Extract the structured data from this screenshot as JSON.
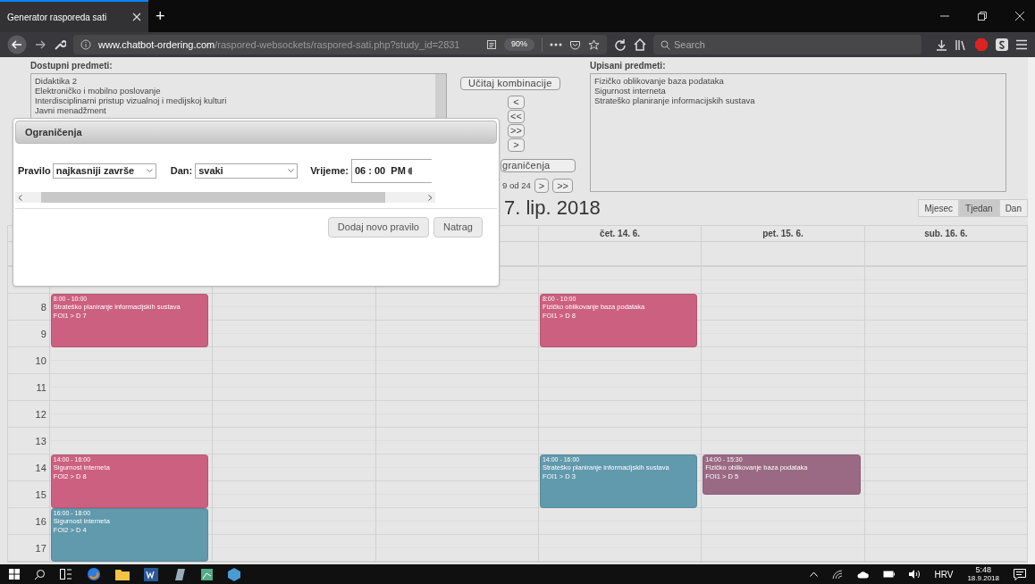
{
  "browser": {
    "tab_title": "Generator rasporeda sati",
    "new_tab": "+",
    "url_domain": "www.chatbot-ordering.com",
    "url_path": "/raspored-websockets/raspored-sati.php?study_id=2831",
    "zoom": "90%",
    "search_placeholder": "Search"
  },
  "available": {
    "label": "Dostupni predmeti:",
    "items": [
      "Didaktika 2",
      "Elektroničko i mobilno poslovanje",
      "Interdisciplinarni pristup vizualnoj i medijskoj kulturi",
      "Javni menadžment"
    ]
  },
  "load_button": "Učitaj kombinacije",
  "move_buttons": [
    "<",
    "<<",
    ">>",
    ">"
  ],
  "constraints_button": "graničenja",
  "pager": {
    "text": "9 od 24",
    "buttons": [
      ">",
      ">>"
    ]
  },
  "enrolled": {
    "label": "Upisani predmeti:",
    "items": [
      "Fizičko oblikovanje baza podataka",
      "Sigurnost interneta",
      "Strateško planiranje informacijskih sustava"
    ]
  },
  "calendar": {
    "title": "7. lip. 2018",
    "views": [
      {
        "label": "Mjesec",
        "selected": false
      },
      {
        "label": "Tjedan",
        "selected": true
      },
      {
        "label": "Dan",
        "selected": false
      }
    ],
    "hours": [
      "8",
      "9",
      "10",
      "11",
      "12",
      "13",
      "14",
      "15",
      "16",
      "17"
    ],
    "columns": [
      {
        "events": [
          {
            "time": "8:00 - 10:00",
            "title": "Strateško planiranje informacijskih sustava",
            "room": "FOI1 > D 7",
            "color": "#cc6080"
          },
          {
            "time": "14:00 - 16:00",
            "title": "Sigurnost interneta",
            "room": "FOI2 > D 8",
            "color": "#cc6080"
          },
          {
            "time": "16:00 - 18:00",
            "title": "Sigurnost interneta",
            "room": "FOI2 > D 4",
            "color": "#6199ad"
          }
        ]
      },
      {},
      {},
      {
        "header": "čet. 14. 6.",
        "events": [
          {
            "time": "8:00 - 10:00",
            "title": "Fizičko oblikovanje baza podataka",
            "room": "FOI1 > D 8",
            "color": "#cc6080"
          },
          {
            "time": "14:00 - 16:00",
            "title": "Strateško planiranje informacijskih sustava",
            "room": "FOI1 > D 3",
            "color": "#6199ad"
          }
        ]
      },
      {
        "header": "pet. 15. 6.",
        "events": [
          {
            "time": "14:00 - 15:30",
            "title": "Fizičko oblikovanje baza podataka",
            "room": "FOI1 > D 5",
            "color": "#9a6a84"
          }
        ]
      },
      {
        "header": "sub. 16. 6."
      }
    ]
  },
  "modal": {
    "title": "Ograničenja",
    "rule_label": "Pravilo",
    "rule_value": "najkasniji završe",
    "day_label": "Dan:",
    "day_value": "svaki",
    "time_label": "Vrijeme:",
    "time_value": "06 : 00  PM",
    "buttons": [
      "Dodaj novo pravilo",
      "Natrag"
    ]
  },
  "taskbar": {
    "language": "HRV",
    "time": "5:48",
    "date": "18.9.2018"
  }
}
